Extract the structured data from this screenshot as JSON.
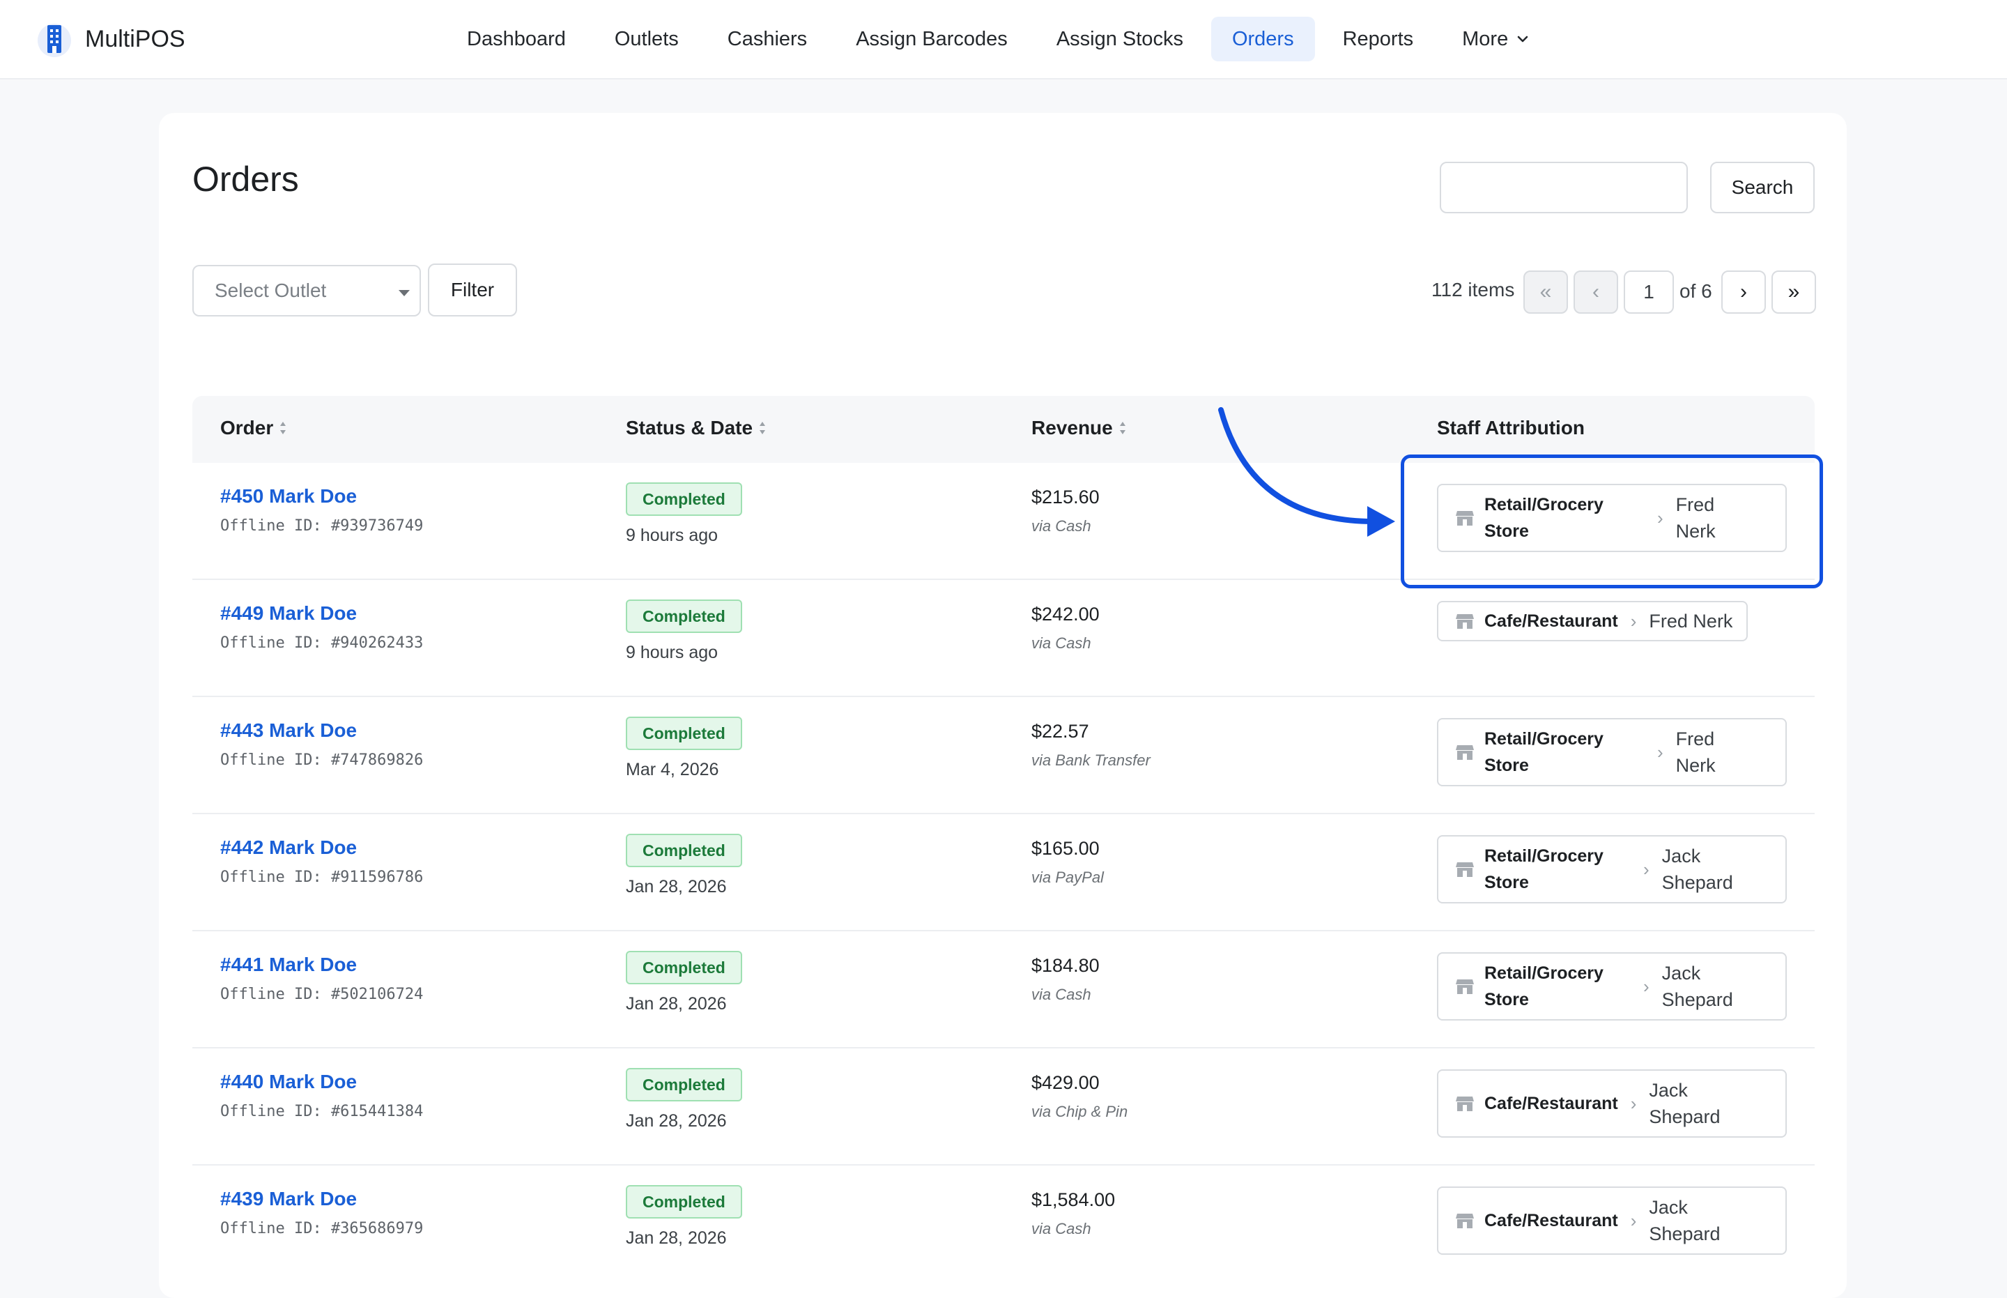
{
  "app": {
    "name": "MultiPOS"
  },
  "nav": {
    "items": [
      {
        "label": "Dashboard"
      },
      {
        "label": "Outlets"
      },
      {
        "label": "Cashiers"
      },
      {
        "label": "Assign Barcodes"
      },
      {
        "label": "Assign Stocks"
      },
      {
        "label": "Orders",
        "active": true
      },
      {
        "label": "Reports"
      },
      {
        "label": "More"
      }
    ]
  },
  "page": {
    "title": "Orders"
  },
  "search": {
    "value": "",
    "placeholder": "",
    "button_label": "Search"
  },
  "filter": {
    "select_placeholder": "Select Outlet",
    "button_label": "Filter"
  },
  "pagination": {
    "items_label": "112 items",
    "first": "«",
    "prev": "‹",
    "current": "1",
    "of_label": "of 6",
    "next": "›",
    "last": "»"
  },
  "table": {
    "columns": [
      "Order",
      "Status & Date",
      "Revenue",
      "Staff Attribution"
    ],
    "rows": [
      {
        "order": "#450 Mark Doe",
        "offline_id": "Offline ID: #939736749",
        "status": "Completed",
        "date": "9 hours ago",
        "revenue": "$215.60",
        "via": "via Cash",
        "store_line1": "Retail/Grocery",
        "store_line2": "Store",
        "staff_line1": "Fred",
        "staff_line2": "Nerk"
      },
      {
        "order": "#449 Mark Doe",
        "offline_id": "Offline ID: #940262433",
        "status": "Completed",
        "date": "9 hours ago",
        "revenue": "$242.00",
        "via": "via Cash",
        "store": "Cafe/Restaurant",
        "staff": "Fred Nerk"
      },
      {
        "order": "#443 Mark Doe",
        "offline_id": "Offline ID: #747869826",
        "status": "Completed",
        "date": "Mar 4, 2026",
        "revenue": "$22.57",
        "via": "via Bank Transfer",
        "store_line1": "Retail/Grocery",
        "store_line2": "Store",
        "staff_line1": "Fred",
        "staff_line2": "Nerk"
      },
      {
        "order": "#442 Mark Doe",
        "offline_id": "Offline ID: #911596786",
        "status": "Completed",
        "date": "Jan 28, 2026",
        "revenue": "$165.00",
        "via": "via PayPal",
        "store_line1": "Retail/Grocery",
        "store_line2": "Store",
        "staff_line1": "Jack",
        "staff_line2": "Shepard"
      },
      {
        "order": "#441 Mark Doe",
        "offline_id": "Offline ID: #502106724",
        "status": "Completed",
        "date": "Jan 28, 2026",
        "revenue": "$184.80",
        "via": "via Cash",
        "store_line1": "Retail/Grocery",
        "store_line2": "Store",
        "staff_line1": "Jack",
        "staff_line2": "Shepard"
      },
      {
        "order": "#440 Mark Doe",
        "offline_id": "Offline ID: #615441384",
        "status": "Completed",
        "date": "Jan 28, 2026",
        "revenue": "$429.00",
        "via": "via Chip & Pin",
        "store": "Cafe/Restaurant",
        "staff_line1": "Jack",
        "staff_line2": "Shepard"
      },
      {
        "order": "#439 Mark Doe",
        "offline_id": "Offline ID: #365686979",
        "status": "Completed",
        "date": "Jan 28, 2026",
        "revenue": "$1,584.00",
        "via": "via Cash",
        "store": "Cafe/Restaurant",
        "staff_line1": "Jack",
        "staff_line2": "Shepard"
      }
    ]
  },
  "colors": {
    "accent": "#1a5fd6",
    "active_nav_bg": "#eaf1fd",
    "badge_bg": "#e4f7ea",
    "badge_text": "#1c7a3a",
    "annotation": "#1150e0"
  },
  "icons": {
    "brand": "building-icon",
    "store": "store-icon",
    "sort": "sort-icon",
    "chevron": "chevron-right-icon"
  }
}
